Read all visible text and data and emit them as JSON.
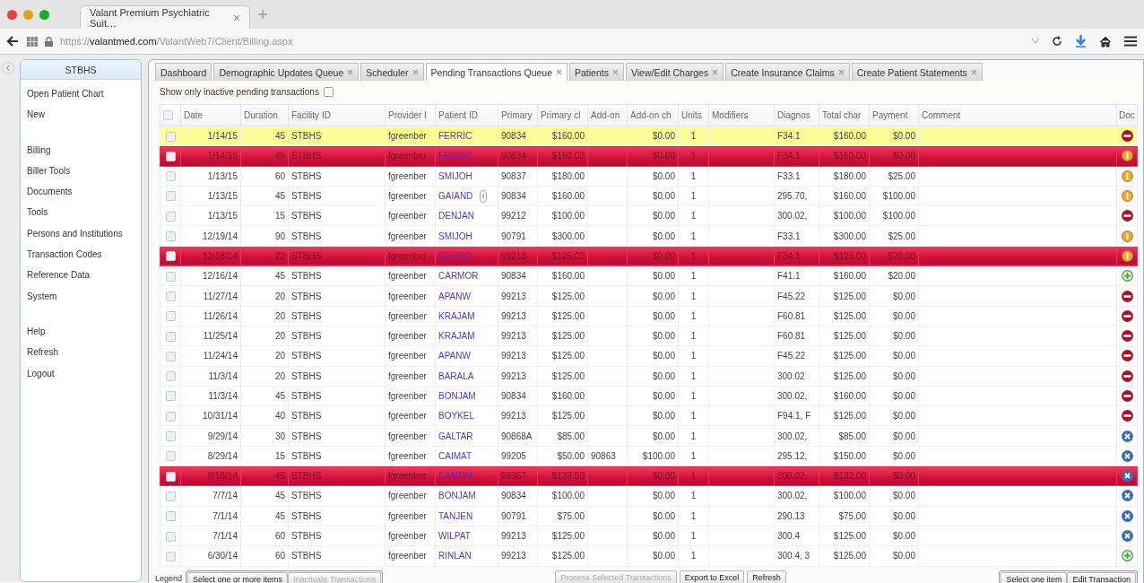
{
  "browser": {
    "tab_title": "Valant Premium Psychiatric Suit…",
    "url": "https://**valantmed.com**/ValantWeb7/Client/Billing.aspx"
  },
  "sidebar": {
    "title": "STBHS",
    "groups": [
      [
        {
          "label": "Open Patient Chart"
        },
        {
          "label": "New"
        }
      ],
      [
        {
          "label": "Billing"
        },
        {
          "label": "Biller Tools"
        },
        {
          "label": "Documents"
        },
        {
          "label": "Tools"
        },
        {
          "label": "Persons and Institutions"
        },
        {
          "label": "Transaction Codes"
        },
        {
          "label": "Reference Data"
        },
        {
          "label": "System"
        }
      ],
      [
        {
          "label": "Help"
        },
        {
          "label": "Refresh"
        },
        {
          "label": "Logout"
        }
      ]
    ]
  },
  "tabs": [
    {
      "label": "Dashboard",
      "closable": false,
      "selected": false
    },
    {
      "label": "Demographic Updates Queue",
      "closable": true,
      "selected": false
    },
    {
      "label": "Scheduler",
      "closable": true,
      "selected": false
    },
    {
      "label": "Pending Transactions Queue",
      "closable": true,
      "selected": true
    },
    {
      "label": "Patients",
      "closable": true,
      "selected": false
    },
    {
      "label": "View/Edit Charges",
      "closable": true,
      "selected": false
    },
    {
      "label": "Create Insurance Claims",
      "closable": true,
      "selected": false
    },
    {
      "label": "Create Patient Statements",
      "closable": true,
      "selected": false
    }
  ],
  "filter": {
    "label": "Show only inactive pending transactions",
    "checked": false
  },
  "table": {
    "header_checked": false,
    "columns": [
      "Date",
      "Duration",
      "Facility ID",
      "Provider I",
      "Patient ID",
      "Primary",
      "Primary cl",
      "Add-on",
      "Add-on ch",
      "Units",
      "Modifiers",
      "Diagnos",
      "Total char",
      "Payment",
      "Comment",
      "Doc"
    ],
    "rows": [
      {
        "checked": false,
        "selected": true,
        "flagged": false,
        "note": false,
        "kind": "minus",
        "cells": [
          "1/14/15",
          "45",
          "STBHS",
          "fgreenber",
          "FERRIC",
          "90834",
          "$160.00",
          null,
          "$0.00",
          "1",
          null,
          "F34.1",
          "$160.00",
          "$0.00",
          null
        ]
      },
      {
        "checked": false,
        "selected": false,
        "flagged": true,
        "note": false,
        "kind": "alert",
        "cells": [
          "1/14/15",
          "45",
          "STBHS",
          "fgreenber",
          "FERRIC",
          "90834",
          "$160.00",
          null,
          "$0.00",
          "1",
          null,
          "F34.1",
          "$160.00",
          "$0.00",
          null
        ]
      },
      {
        "checked": false,
        "selected": false,
        "flagged": false,
        "note": false,
        "kind": "alert",
        "cells": [
          "1/13/15",
          "60",
          "STBHS",
          "fgreenber",
          "SMIJOH",
          "90837",
          "$180.00",
          null,
          "$0.00",
          "1",
          null,
          "F33.1",
          "$180.00",
          "$25.00",
          null
        ]
      },
      {
        "checked": false,
        "selected": false,
        "flagged": false,
        "note": true,
        "kind": "alert",
        "cells": [
          "1/13/15",
          "45",
          "STBHS",
          "fgreenber",
          "GAIAND",
          "90834",
          "$160.00",
          null,
          "$0.00",
          "1",
          null,
          "295.70,",
          "$160.00",
          "$100.00",
          null
        ]
      },
      {
        "checked": false,
        "selected": false,
        "flagged": false,
        "note": false,
        "kind": "minus",
        "cells": [
          "1/13/15",
          "15",
          "STBHS",
          "fgreenber",
          "DENJAN",
          "99212",
          "$100.00",
          null,
          "$0.00",
          "1",
          null,
          "300.02,",
          "$100.00",
          "$100.00",
          null
        ]
      },
      {
        "checked": false,
        "selected": false,
        "flagged": false,
        "note": false,
        "kind": "alert",
        "cells": [
          "12/19/14",
          "90",
          "STBHS",
          "fgreenber",
          "SMIJOH",
          "90791",
          "$300.00",
          null,
          "$0.00",
          "1",
          null,
          "F33.1",
          "$300.00",
          "$25.00",
          null
        ]
      },
      {
        "checked": false,
        "selected": false,
        "flagged": true,
        "note": false,
        "kind": "alert",
        "cells": [
          "12/18/14",
          "20",
          "STBHS",
          "fgreenber",
          "FERRIC",
          "99213",
          "$125.00",
          null,
          "$0.00",
          "1",
          null,
          "F34.1",
          "$125.00",
          "$20.00",
          null
        ]
      },
      {
        "checked": false,
        "selected": false,
        "flagged": false,
        "note": false,
        "kind": "plus",
        "cells": [
          "12/16/14",
          "45",
          "STBHS",
          "fgreenber",
          "CARMOR",
          "90834",
          "$160.00",
          null,
          "$0.00",
          "1",
          null,
          "F41.1",
          "$160.00",
          "$20.00",
          null
        ]
      },
      {
        "checked": false,
        "selected": false,
        "flagged": false,
        "note": false,
        "kind": "minus",
        "cells": [
          "11/27/14",
          "20",
          "STBHS",
          "fgreenber",
          "APANW",
          "99213",
          "$125.00",
          null,
          "$0.00",
          "1",
          null,
          "F45.22",
          "$125.00",
          "$0.00",
          null
        ]
      },
      {
        "checked": false,
        "selected": false,
        "flagged": false,
        "note": false,
        "kind": "minus",
        "cells": [
          "11/26/14",
          "20",
          "STBHS",
          "fgreenber",
          "KRAJAM",
          "99213",
          "$125.00",
          null,
          "$0.00",
          "1",
          null,
          "F60.81",
          "$125.00",
          "$0.00",
          null
        ]
      },
      {
        "checked": false,
        "selected": false,
        "flagged": false,
        "note": false,
        "kind": "minus",
        "cells": [
          "11/25/14",
          "20",
          "STBHS",
          "fgreenber",
          "KRAJAM",
          "99213",
          "$125.00",
          null,
          "$0.00",
          "1",
          null,
          "F60.81",
          "$125.00",
          "$0.00",
          null
        ]
      },
      {
        "checked": false,
        "selected": false,
        "flagged": false,
        "note": false,
        "kind": "minus",
        "cells": [
          "11/24/14",
          "20",
          "STBHS",
          "fgreenber",
          "APANW",
          "99213",
          "$125.00",
          null,
          "$0.00",
          "1",
          null,
          "F45.22",
          "$125.00",
          "$0.00",
          null
        ]
      },
      {
        "checked": false,
        "selected": false,
        "flagged": false,
        "note": false,
        "kind": "minus",
        "cells": [
          "11/3/14",
          "20",
          "STBHS",
          "fgreenber",
          "BARALA",
          "99213",
          "$125.00",
          null,
          "$0.00",
          "1",
          null,
          "300.02",
          "$125.00",
          "$0.00",
          null
        ]
      },
      {
        "checked": false,
        "selected": false,
        "flagged": false,
        "note": false,
        "kind": "minus",
        "cells": [
          "11/3/14",
          "45",
          "STBHS",
          "fgreenber",
          "BONJAM",
          "90834",
          "$160.00",
          null,
          "$0.00",
          "1",
          null,
          "300.02,",
          "$160.00",
          "$0.00",
          null
        ]
      },
      {
        "checked": false,
        "selected": false,
        "flagged": false,
        "note": false,
        "kind": "minus",
        "cells": [
          "10/31/14",
          "40",
          "STBHS",
          "fgreenber",
          "BOYKEL",
          "99213",
          "$125.00",
          null,
          "$0.00",
          "1",
          null,
          "F94.1, F",
          "$125.00",
          "$0.00",
          null
        ]
      },
      {
        "checked": false,
        "selected": false,
        "flagged": false,
        "note": false,
        "kind": "x",
        "cells": [
          "9/29/14",
          "30",
          "STBHS",
          "fgreenber",
          "GALTAR",
          "90868A",
          "$85.00",
          null,
          "$0.00",
          "1",
          null,
          "300.02,",
          "$85.00",
          "$0.00",
          null
        ]
      },
      {
        "checked": false,
        "selected": false,
        "flagged": false,
        "note": false,
        "kind": "x",
        "cells": [
          "8/29/14",
          "15",
          "STBHS",
          "fgreenber",
          "CAIMAT",
          "99205",
          "$50.00",
          "90863",
          "$100.00",
          "1",
          null,
          "295.12,",
          "$150.00",
          "$0.00",
          null
        ]
      },
      {
        "checked": false,
        "selected": false,
        "flagged": true,
        "note": false,
        "kind": "x",
        "cells": [
          "8/18/14",
          "45",
          "STBHS",
          "fgreenber",
          "CANTIM",
          "99367",
          "$132.00",
          null,
          "$0.00",
          "1",
          null,
          "300.02,",
          "$132.00",
          "$0.00",
          null
        ]
      },
      {
        "checked": false,
        "selected": false,
        "flagged": false,
        "note": false,
        "kind": "x",
        "cells": [
          "7/7/14",
          "45",
          "STBHS",
          "fgreenber",
          "BONJAM",
          "90834",
          "$100.00",
          null,
          "$0.00",
          "1",
          null,
          "300.02,",
          "$100.00",
          "$0.00",
          null
        ]
      },
      {
        "checked": false,
        "selected": false,
        "flagged": false,
        "note": false,
        "kind": "x",
        "cells": [
          "7/1/14",
          "45",
          "STBHS",
          "fgreenber",
          "TANJEN",
          "90791",
          "$75.00",
          null,
          "$0.00",
          "1",
          null,
          "290.13",
          "$75.00",
          "$0.00",
          null
        ]
      },
      {
        "checked": false,
        "selected": false,
        "flagged": false,
        "note": false,
        "kind": "x",
        "cells": [
          "7/1/14",
          "60",
          "STBHS",
          "fgreenber",
          "WILPAT",
          "99213",
          "$125.00",
          null,
          "$0.00",
          "1",
          null,
          "300.4",
          "$125.00",
          "$0.00",
          null
        ]
      },
      {
        "checked": false,
        "selected": false,
        "flagged": false,
        "note": false,
        "kind": "plus",
        "cells": [
          "6/30/14",
          "60",
          "STBHS",
          "fgreenber",
          "RINLAN",
          "99213",
          "$125.00",
          null,
          "$0.00",
          "1",
          null,
          "300.4, 3",
          "$125.00",
          "$0.00",
          null
        ]
      }
    ]
  },
  "footer": {
    "legend": "Legend",
    "left_group": [
      {
        "label": "Select one or more items",
        "disabled": false
      },
      {
        "label": "Inactivate Transactions",
        "disabled": true
      }
    ],
    "buttons": [
      {
        "label": "Process Selected Transactions",
        "disabled": true
      },
      {
        "label": "Export to Excel",
        "disabled": false
      },
      {
        "label": "Refresh",
        "disabled": false
      }
    ],
    "right_group": [
      {
        "label": "Select one item",
        "disabled": false
      },
      {
        "label": "Edit Transaction",
        "disabled": false
      }
    ]
  }
}
